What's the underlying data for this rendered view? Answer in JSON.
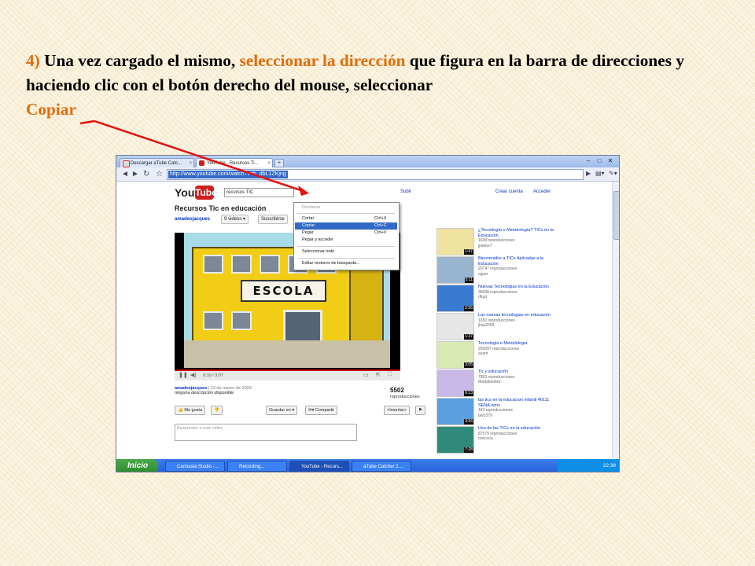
{
  "instruction": {
    "step": "4)",
    "part1": " Una vez cargado el mismo, ",
    "highlight1": "seleccionar la dirección",
    "part2": " que figura en la barra de direcciones y haciendo clic con el botón derecho del mouse, seleccionar ",
    "highlight2": "Copiar"
  },
  "colors": {
    "highlight": "#e36c0a",
    "arrow": "#e81010",
    "menu_selection": "#3169c6",
    "youtube_red": "#cc1f1f"
  },
  "browser": {
    "tabs": [
      {
        "label": "Descargar aTube Catc...",
        "icon": "youtube-favicon-icon"
      },
      {
        "label": "YouTube - Recursos Ti...",
        "icon": "youtube-favicon-icon"
      }
    ],
    "address_url": "http://www.youtube.com/watch?v=h_dbL1ZKjng"
  },
  "page": {
    "logo_you": "You",
    "logo_tube": "Tube",
    "search_value": "recursos TIC",
    "upload": "Subir",
    "create_account": "Crear cuenta",
    "sign_in": "Acceder",
    "channel_title": "Recursos Tic en educación",
    "channel_user": "amadeojacques",
    "videos_count": "9 videos",
    "subscribe": "Suscribirse",
    "video_sign": "ESCOLA",
    "time": "0:10 / 3:07",
    "uploader": "amadeojacques",
    "upload_date": "23 de marzo de 2009",
    "description": "ninguna descripción disponible",
    "views": "5502",
    "views_label": "reproducciones",
    "like": "Me gusta",
    "save_to": "Guardar en",
    "share": "Compartir",
    "embed": "<Insertar>",
    "comment_placeholder": "Responder a este video"
  },
  "context_menu": {
    "undo": "Deshacer",
    "cut": "Cortar",
    "cut_shortcut": "Ctrl+X",
    "copy": "Copiar",
    "copy_shortcut": "Ctrl+C",
    "paste": "Pegar",
    "paste_shortcut": "Ctrl+V",
    "paste_go": "Pegar y acceder",
    "select_all": "Seleccionar todo",
    "edit_engines": "Editar motores de búsqueda..."
  },
  "related": [
    {
      "title": "¿Tecnología o Metodología? TICs en la Educación",
      "views": "1639 reproducciones",
      "user": "jpaime7",
      "duration": "1:47"
    },
    {
      "title": "Bienvenidos a TICs Aplicadas a la Educación",
      "views": "20747 reproducciones",
      "user": "cguer",
      "duration": "5:11"
    },
    {
      "title": "Nuevas Tecnologias en la Educación",
      "views": "36698 reproducciones",
      "user": "rflupi",
      "duration": "2:56"
    },
    {
      "title": "Las nuevas tecnologias en educacion",
      "views": "1650 reproducciones",
      "user": "jhas2009",
      "duration": "1:27"
    },
    {
      "title": "Tecnologia e Metodologia",
      "views": "299397 reproducciones",
      "user": "acartr",
      "duration": "3:05"
    },
    {
      "title": "Tic y educación",
      "views": "7893 reproducciones",
      "user": "Martabenitez",
      "duration": "6:13"
    },
    {
      "title": "las tics en la educacion infantil 40111 SENA.wmv",
      "views": "443 reproducciones",
      "user": "tavo379",
      "duration": "3:56"
    },
    {
      "title": "Uso de las TICs en la educación",
      "views": "87579 reproducciones",
      "user": "ceecoca",
      "duration": "7:28"
    }
  ],
  "taskbar": {
    "start": "Inicio",
    "items": [
      "Camtasia Studio -...",
      "Recording...",
      "YouTube - Recurs...",
      "aTube Catcher 2...."
    ],
    "clock": "22:38"
  }
}
